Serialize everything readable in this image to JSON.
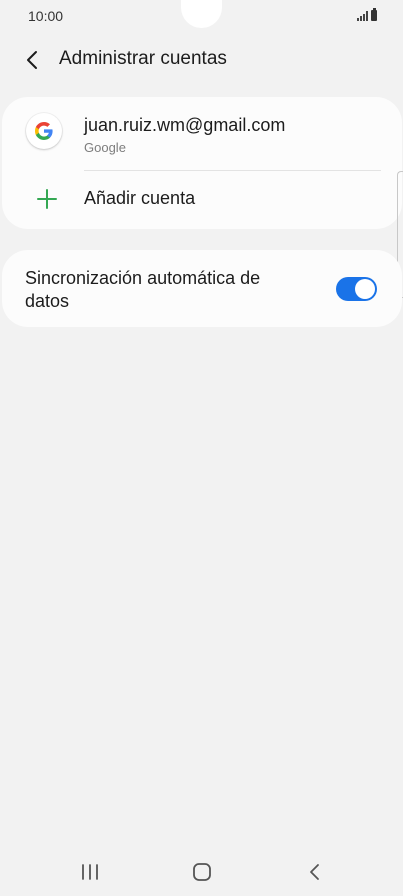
{
  "status_bar": {
    "time": "10:00"
  },
  "header": {
    "title": "Administrar cuentas"
  },
  "accounts": [
    {
      "email": "juan.ruiz.wm@gmail.com",
      "provider": "Google",
      "icon": "google-icon"
    }
  ],
  "add_account": {
    "label": "Añadir cuenta",
    "icon": "plus-icon"
  },
  "sync": {
    "label": "Sincronización automática de datos",
    "enabled": true
  },
  "colors": {
    "accent": "#1a73e8",
    "add_green": "#34a853",
    "background": "#f2f2f2",
    "card": "#fcfcfc"
  },
  "nav": {
    "recents_icon": "recents-icon",
    "home_icon": "home-icon",
    "back_icon": "back-icon"
  }
}
